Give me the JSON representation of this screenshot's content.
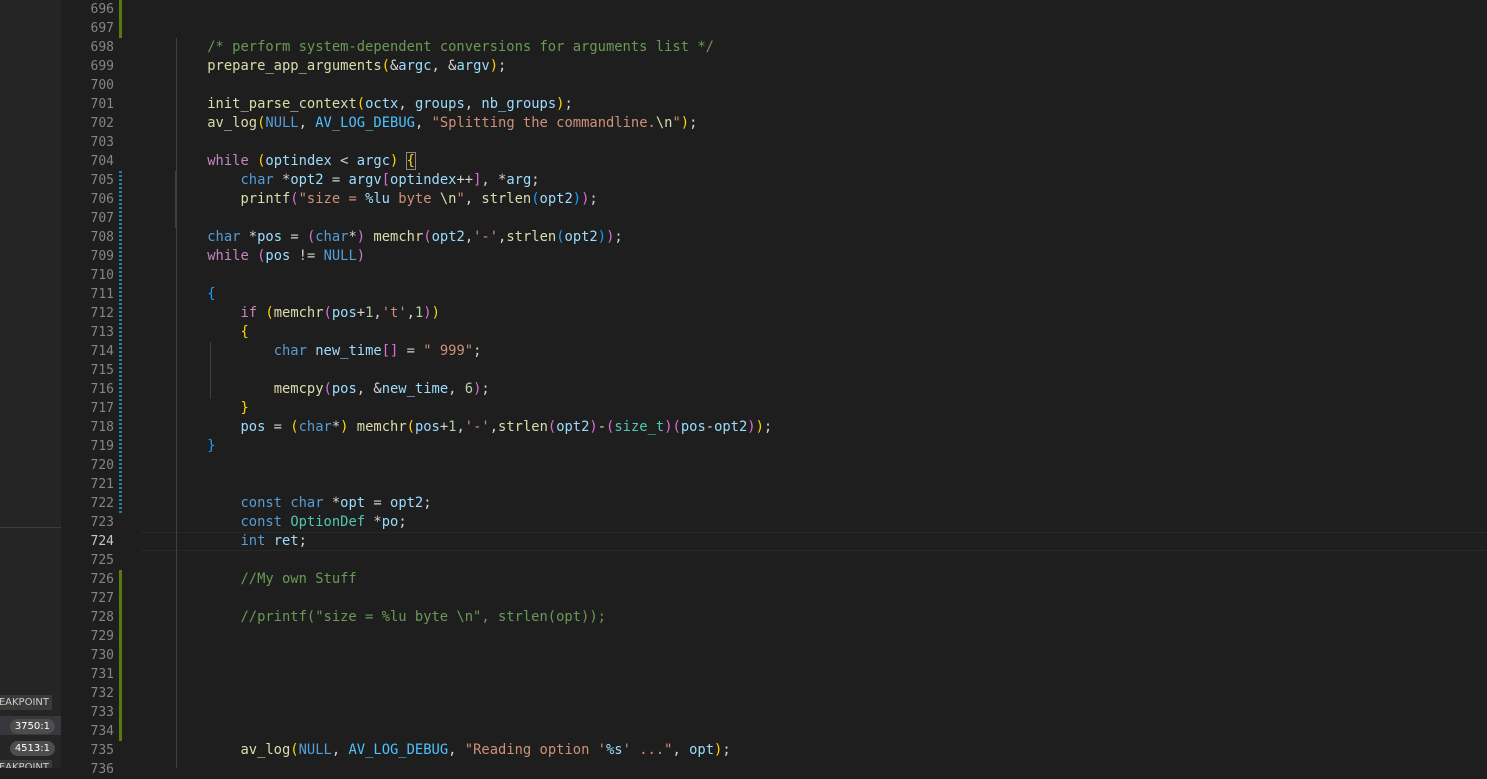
{
  "breakpoints": {
    "header_1": "EAKPOINT",
    "item_1": "3750:1",
    "item_2": "4513:1",
    "header_2": "EAKPOINT"
  },
  "editor": {
    "active_line": 724,
    "lines": [
      {
        "n": 696,
        "toks": []
      },
      {
        "n": 697,
        "toks": []
      },
      {
        "n": 698,
        "toks": [
          [
            "    ",
            ""
          ],
          [
            "/* perform system-dependent conversions for arguments list */",
            "cm"
          ]
        ]
      },
      {
        "n": 699,
        "toks": [
          [
            "    ",
            ""
          ],
          [
            "prepare_app_arguments",
            "fn"
          ],
          [
            "(",
            "p1"
          ],
          [
            "&",
            "op"
          ],
          [
            "argc",
            "var"
          ],
          [
            ", &",
            "op"
          ],
          [
            "argv",
            "var"
          ],
          [
            ")",
            "p1"
          ],
          [
            ";",
            "op"
          ]
        ]
      },
      {
        "n": 700,
        "toks": []
      },
      {
        "n": 701,
        "toks": [
          [
            "    ",
            ""
          ],
          [
            "init_parse_context",
            "fn"
          ],
          [
            "(",
            "p1"
          ],
          [
            "octx",
            "var"
          ],
          [
            ", ",
            "op"
          ],
          [
            "groups",
            "var"
          ],
          [
            ", ",
            "op"
          ],
          [
            "nb_groups",
            "var"
          ],
          [
            ")",
            "p1"
          ],
          [
            ";",
            "op"
          ]
        ]
      },
      {
        "n": 702,
        "toks": [
          [
            "    ",
            ""
          ],
          [
            "av_log",
            "fn"
          ],
          [
            "(",
            "p1"
          ],
          [
            "NULL",
            "kw"
          ],
          [
            ", ",
            "op"
          ],
          [
            "AV_LOG_DEBUG",
            "macro"
          ],
          [
            ", ",
            "op"
          ],
          [
            "\"Splitting the commandline.",
            "str"
          ],
          [
            "\\n",
            "fn"
          ],
          [
            "\"",
            "str"
          ],
          [
            ")",
            "p1"
          ],
          [
            ";",
            "op"
          ]
        ]
      },
      {
        "n": 703,
        "toks": []
      },
      {
        "n": 704,
        "toks": [
          [
            "    ",
            ""
          ],
          [
            "while",
            "ctl"
          ],
          [
            " ",
            "op"
          ],
          [
            "(",
            "p1"
          ],
          [
            "optindex",
            "var"
          ],
          [
            " < ",
            "op"
          ],
          [
            "argc",
            "var"
          ],
          [
            ")",
            "p1"
          ],
          [
            " ",
            "op"
          ],
          [
            "{",
            "p1 bmatch"
          ]
        ]
      },
      {
        "n": 705,
        "toks": [
          [
            "        ",
            ""
          ],
          [
            "char",
            "kw"
          ],
          [
            " *",
            "op"
          ],
          [
            "opt2",
            "var"
          ],
          [
            " = ",
            "op"
          ],
          [
            "argv",
            "var"
          ],
          [
            "[",
            "p2"
          ],
          [
            "optindex",
            "var"
          ],
          [
            "++",
            "op"
          ],
          [
            "]",
            "p2"
          ],
          [
            ", *",
            "op"
          ],
          [
            "arg",
            "var"
          ],
          [
            ";",
            "op"
          ]
        ]
      },
      {
        "n": 706,
        "toks": [
          [
            "        ",
            ""
          ],
          [
            "printf",
            "fn"
          ],
          [
            "(",
            "p2"
          ],
          [
            "\"size = ",
            "str"
          ],
          [
            "%lu",
            "var"
          ],
          [
            " byte ",
            "str"
          ],
          [
            "\\n",
            "fn"
          ],
          [
            "\"",
            "str"
          ],
          [
            ", ",
            "op"
          ],
          [
            "strlen",
            "fn"
          ],
          [
            "(",
            "p3"
          ],
          [
            "opt2",
            "var"
          ],
          [
            ")",
            "p3"
          ],
          [
            ")",
            "p2"
          ],
          [
            ";",
            "op"
          ]
        ]
      },
      {
        "n": 707,
        "toks": []
      },
      {
        "n": 708,
        "toks": [
          [
            "    ",
            ""
          ],
          [
            "char",
            "kw"
          ],
          [
            " *",
            "op"
          ],
          [
            "pos",
            "var"
          ],
          [
            " = ",
            "op"
          ],
          [
            "(",
            "p2"
          ],
          [
            "char",
            "kw"
          ],
          [
            "*",
            "op"
          ],
          [
            ")",
            "p2"
          ],
          [
            " ",
            "op"
          ],
          [
            "memchr",
            "fn"
          ],
          [
            "(",
            "p2"
          ],
          [
            "opt2",
            "var"
          ],
          [
            ",",
            "op"
          ],
          [
            "'-'",
            "str"
          ],
          [
            ",",
            "op"
          ],
          [
            "strlen",
            "fn"
          ],
          [
            "(",
            "p3"
          ],
          [
            "opt2",
            "var"
          ],
          [
            ")",
            "p3"
          ],
          [
            ")",
            "p2"
          ],
          [
            ";",
            "op"
          ]
        ]
      },
      {
        "n": 709,
        "toks": [
          [
            "    ",
            ""
          ],
          [
            "while",
            "ctl"
          ],
          [
            " ",
            "op"
          ],
          [
            "(",
            "p2"
          ],
          [
            "pos",
            "var"
          ],
          [
            " != ",
            "op"
          ],
          [
            "NULL",
            "kw"
          ],
          [
            ")",
            "p2"
          ]
        ]
      },
      {
        "n": 710,
        "toks": []
      },
      {
        "n": 711,
        "toks": [
          [
            "    ",
            ""
          ],
          [
            "{",
            "p3"
          ]
        ]
      },
      {
        "n": 712,
        "toks": [
          [
            "        ",
            ""
          ],
          [
            "if",
            "ctl"
          ],
          [
            " ",
            "op"
          ],
          [
            "(",
            "p1"
          ],
          [
            "memchr",
            "fn"
          ],
          [
            "(",
            "p2"
          ],
          [
            "pos",
            "var"
          ],
          [
            "+",
            "op"
          ],
          [
            "1",
            "num"
          ],
          [
            ",",
            "op"
          ],
          [
            "'t'",
            "str"
          ],
          [
            ",",
            "op"
          ],
          [
            "1",
            "num"
          ],
          [
            ")",
            "p2"
          ],
          [
            ")",
            "p1"
          ]
        ]
      },
      {
        "n": 713,
        "toks": [
          [
            "        ",
            ""
          ],
          [
            "{",
            "p1"
          ]
        ]
      },
      {
        "n": 714,
        "toks": [
          [
            "            ",
            ""
          ],
          [
            "char",
            "kw"
          ],
          [
            " ",
            "op"
          ],
          [
            "new_time",
            "var"
          ],
          [
            "[]",
            "p2"
          ],
          [
            " = ",
            "op"
          ],
          [
            "\" 999\"",
            "str"
          ],
          [
            ";",
            "op"
          ]
        ]
      },
      {
        "n": 715,
        "toks": []
      },
      {
        "n": 716,
        "toks": [
          [
            "            ",
            ""
          ],
          [
            "memcpy",
            "fn"
          ],
          [
            "(",
            "p2"
          ],
          [
            "pos",
            "var"
          ],
          [
            ", &",
            "op"
          ],
          [
            "new_time",
            "var"
          ],
          [
            ", ",
            "op"
          ],
          [
            "6",
            "num"
          ],
          [
            ")",
            "p2"
          ],
          [
            ";",
            "op"
          ]
        ]
      },
      {
        "n": 717,
        "toks": [
          [
            "        ",
            ""
          ],
          [
            "}",
            "p1"
          ]
        ]
      },
      {
        "n": 718,
        "toks": [
          [
            "        ",
            ""
          ],
          [
            "pos",
            "var"
          ],
          [
            " = ",
            "op"
          ],
          [
            "(",
            "p1"
          ],
          [
            "char",
            "kw"
          ],
          [
            "*",
            "op"
          ],
          [
            ")",
            "p1"
          ],
          [
            " ",
            "op"
          ],
          [
            "memchr",
            "fn"
          ],
          [
            "(",
            "p1"
          ],
          [
            "pos",
            "var"
          ],
          [
            "+",
            "op"
          ],
          [
            "1",
            "num"
          ],
          [
            ",",
            "op"
          ],
          [
            "'-'",
            "str"
          ],
          [
            ",",
            "op"
          ],
          [
            "strlen",
            "fn"
          ],
          [
            "(",
            "p2"
          ],
          [
            "opt2",
            "var"
          ],
          [
            ")",
            "p2"
          ],
          [
            "-",
            "op"
          ],
          [
            "(",
            "p2"
          ],
          [
            "size_t",
            "ty"
          ],
          [
            ")",
            "p2"
          ],
          [
            "(",
            "p2"
          ],
          [
            "pos",
            "var"
          ],
          [
            "-",
            "op"
          ],
          [
            "opt2",
            "var"
          ],
          [
            ")",
            "p2"
          ],
          [
            ")",
            "p1"
          ],
          [
            ";",
            "op"
          ]
        ]
      },
      {
        "n": 719,
        "toks": [
          [
            "    ",
            ""
          ],
          [
            "}",
            "p3"
          ]
        ]
      },
      {
        "n": 720,
        "toks": []
      },
      {
        "n": 721,
        "toks": []
      },
      {
        "n": 722,
        "toks": [
          [
            "        ",
            ""
          ],
          [
            "const",
            "kw"
          ],
          [
            " ",
            "op"
          ],
          [
            "char",
            "kw"
          ],
          [
            " *",
            "op"
          ],
          [
            "opt",
            "var"
          ],
          [
            " = ",
            "op"
          ],
          [
            "opt2",
            "var"
          ],
          [
            ";",
            "op"
          ]
        ]
      },
      {
        "n": 723,
        "toks": [
          [
            "        ",
            ""
          ],
          [
            "const",
            "kw"
          ],
          [
            " ",
            "op"
          ],
          [
            "OptionDef",
            "ty"
          ],
          [
            " *",
            "op"
          ],
          [
            "po",
            "var"
          ],
          [
            ";",
            "op"
          ]
        ]
      },
      {
        "n": 724,
        "toks": [
          [
            "        ",
            ""
          ],
          [
            "int",
            "kw"
          ],
          [
            " ",
            "op"
          ],
          [
            "ret",
            "var"
          ],
          [
            ";",
            "op"
          ]
        ]
      },
      {
        "n": 725,
        "toks": []
      },
      {
        "n": 726,
        "toks": [
          [
            "        ",
            ""
          ],
          [
            "//My own Stuff",
            "cm"
          ]
        ]
      },
      {
        "n": 727,
        "toks": []
      },
      {
        "n": 728,
        "toks": [
          [
            "        ",
            ""
          ],
          [
            "//printf(\"size = %lu byte \\n\", strlen(opt));",
            "cm"
          ]
        ]
      },
      {
        "n": 729,
        "toks": []
      },
      {
        "n": 730,
        "toks": []
      },
      {
        "n": 731,
        "toks": []
      },
      {
        "n": 732,
        "toks": []
      },
      {
        "n": 733,
        "toks": []
      },
      {
        "n": 734,
        "toks": []
      },
      {
        "n": 735,
        "toks": [
          [
            "        ",
            ""
          ],
          [
            "av_log",
            "fn"
          ],
          [
            "(",
            "p1"
          ],
          [
            "NULL",
            "kw"
          ],
          [
            ", ",
            "op"
          ],
          [
            "AV_LOG_DEBUG",
            "macro"
          ],
          [
            ", ",
            "op"
          ],
          [
            "\"Reading option '",
            "str"
          ],
          [
            "%s",
            "var"
          ],
          [
            "' ...\"",
            "str"
          ],
          [
            ", ",
            "op"
          ],
          [
            "opt",
            "var"
          ],
          [
            ")",
            "p1"
          ],
          [
            ";",
            "op"
          ]
        ]
      },
      {
        "n": 736,
        "toks": []
      }
    ]
  }
}
